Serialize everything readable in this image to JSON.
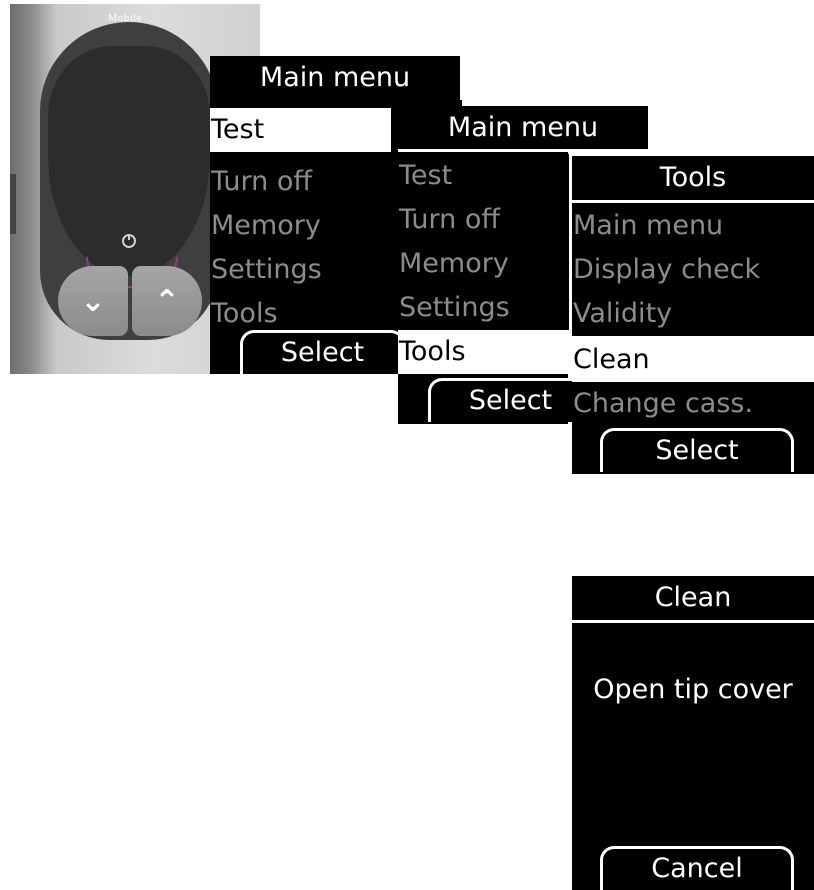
{
  "device": {
    "brand": "Mobile",
    "buttons": {
      "down_icon": "chevron-down-icon",
      "up_icon": "chevron-up-icon",
      "power_icon": "power-icon"
    }
  },
  "screens": [
    {
      "title": "Main menu",
      "items": [
        "Test",
        "Turn off",
        "Memory",
        "Settings",
        "Tools"
      ],
      "selected": "Test",
      "softkey": "Select"
    },
    {
      "title": "Main menu",
      "items": [
        "Test",
        "Turn off",
        "Memory",
        "Settings",
        "Tools"
      ],
      "selected": "Tools",
      "softkey": "Select"
    },
    {
      "title": "Tools",
      "items": [
        "Main menu",
        "Display check",
        "Validity",
        "Clean",
        "Change cass."
      ],
      "selected": "Clean",
      "softkey": "Select"
    },
    {
      "title": "Clean",
      "message": "Open tip cover",
      "softkey": "Cancel"
    }
  ],
  "colors": {
    "lcd_background": "#000000",
    "lcd_text": "#ffffff",
    "inactive_text": "#8c8c8c",
    "select_key_outline": "#8e3c8e"
  }
}
